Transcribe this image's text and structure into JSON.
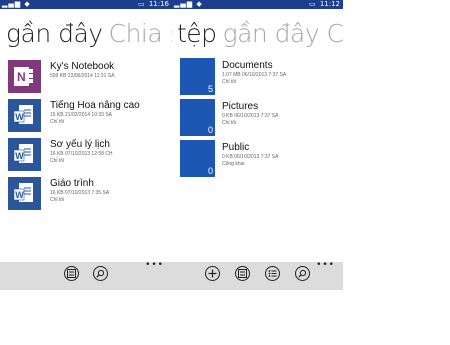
{
  "left": {
    "status": {
      "time": "11:16"
    },
    "pivot": {
      "active": "gần đây",
      "next": "Chia s"
    },
    "files": [
      {
        "name": "Ky's Notebook",
        "info": "599 KB  22/06/2014 11:31 SA",
        "owner": "",
        "type": "onenote"
      },
      {
        "name": "Tiếng Hoa nâng cao",
        "info": "15 KB  21/02/2014 10:33 SA",
        "owner": "Chỉ tôi",
        "type": "word"
      },
      {
        "name": "Sơ yếu lý lịch",
        "info": "16 KB  07/10/2013 12:58 CH",
        "owner": "Chỉ tôi",
        "type": "word"
      },
      {
        "name": "Giáo trình",
        "info": "16 KB  07/10/2013 7:35 SA",
        "owner": "Chỉ tôi",
        "type": "word"
      }
    ],
    "appbar": {
      "more": "•••"
    }
  },
  "right": {
    "status": {
      "time": "11:12"
    },
    "pivot": {
      "active": "tệp",
      "next": "gần đây  Ch"
    },
    "folders": [
      {
        "name": "Documents",
        "info": "1.07 MB  06/10/2013 7:37 SA",
        "owner": "Chỉ tôi",
        "count": "5"
      },
      {
        "name": "Pictures",
        "info": "0 KB  06/10/2013 7:37 SA",
        "owner": "Chỉ tôi",
        "count": "0"
      },
      {
        "name": "Public",
        "info": "0 KB  06/10/2013 7:37 SA",
        "owner": "Công khai",
        "count": "0"
      }
    ],
    "appbar": {
      "more": "•••"
    }
  },
  "colors": {
    "statusbar": "#1e3d8f",
    "folder_tile": "#1e56b4",
    "onenote": "#80397b",
    "word": "#2b579a",
    "appbar": "#dcdcdc"
  },
  "icons": {
    "appbar_left": [
      "list-view-icon",
      "search-icon"
    ],
    "appbar_right": [
      "add-icon",
      "list-view-icon",
      "select-icon",
      "search-icon"
    ]
  }
}
